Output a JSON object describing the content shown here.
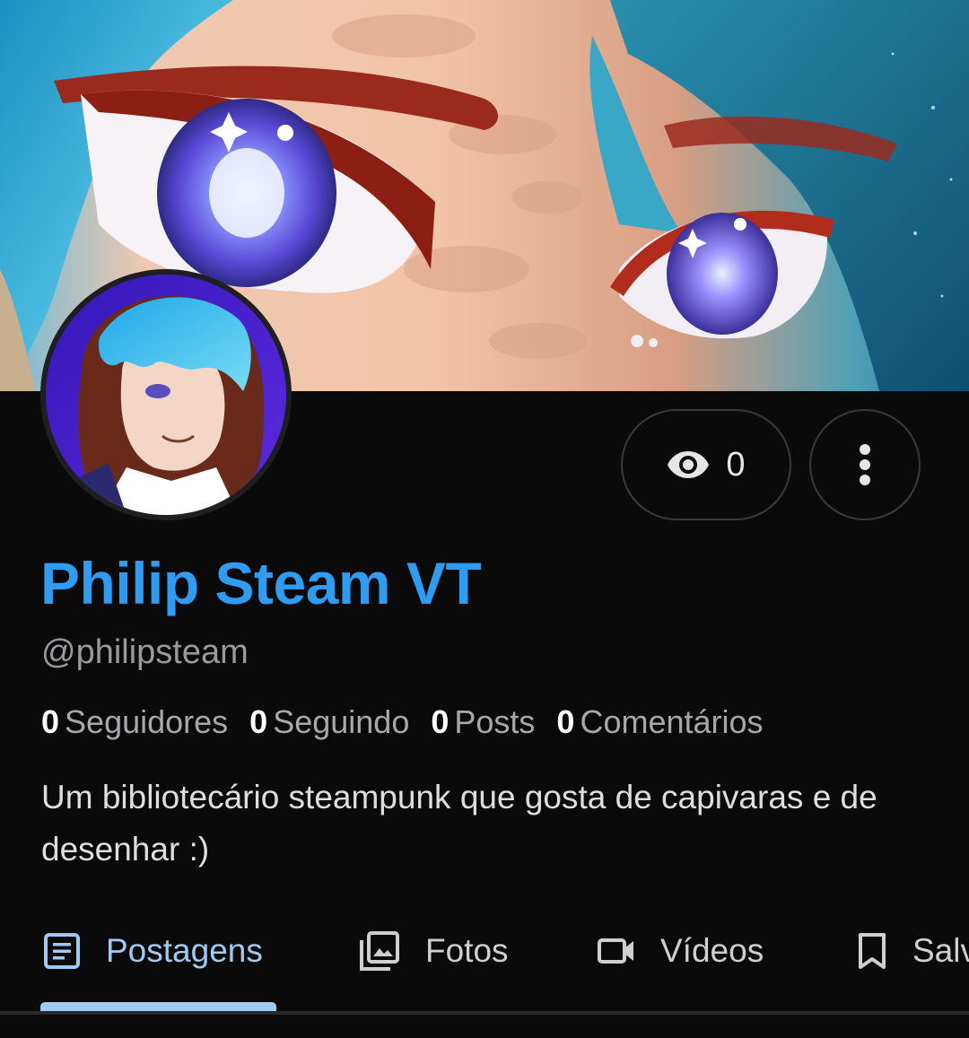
{
  "profile": {
    "display_name": "Philip Steam VT",
    "handle": "@philipsteam",
    "bio": "Um bibliotecário steampunk que gosta de capivaras e de desenhar :)",
    "views": "0"
  },
  "stats": [
    {
      "value": "0",
      "label": "Seguidores"
    },
    {
      "value": "0",
      "label": "Seguindo"
    },
    {
      "value": "0",
      "label": "Posts"
    },
    {
      "value": "0",
      "label": "Comentários"
    }
  ],
  "tabs": [
    {
      "label": "Postagens",
      "icon": "article-icon",
      "active": true
    },
    {
      "label": "Fotos",
      "icon": "photo-library-icon",
      "active": false
    },
    {
      "label": "Vídeos",
      "icon": "videocam-icon",
      "active": false
    },
    {
      "label": "Salvos",
      "icon": "bookmark-icon",
      "active": false
    }
  ],
  "colors": {
    "accent_name": "#2f9cf3",
    "active_tab": "#9ecbf3",
    "background": "#0a0a0b"
  }
}
